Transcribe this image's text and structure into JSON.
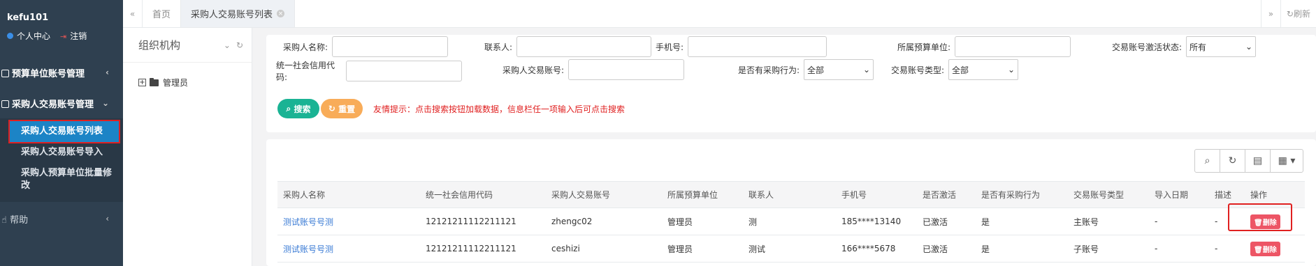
{
  "user": {
    "name": "kefu101",
    "personal": "个人中心",
    "logout": "注销"
  },
  "sidebar": {
    "group1": "预算单位账号管理",
    "group2": "采购人交易账号管理",
    "items": [
      "采购人交易账号列表",
      "采购人交易账号导入",
      "采购人预算单位批量修改"
    ],
    "help": "帮助"
  },
  "tabs": {
    "home": "首页",
    "current": "采购人交易账号列表",
    "refresh": "刷新"
  },
  "tree": {
    "title": "组织机构",
    "node": "管理员"
  },
  "search": {
    "buyer_name": "采购人名称:",
    "contact": "联系人:",
    "phone": "手机号:",
    "budget_unit": "所属预算单位:",
    "activation_status": "交易账号激活状态:",
    "activation_value": "所有",
    "credit_code": "统一社会信用代码:",
    "trade_account": "采购人交易账号:",
    "has_purchase": "是否有采购行为:",
    "has_purchase_value": "全部",
    "account_type": "交易账号类型:",
    "account_type_value": "全部",
    "search_btn": "搜索",
    "reset_btn": "重置",
    "hint": "友情提示：点击搜索按钮加载数据，信息栏任一项输入后可点击搜索"
  },
  "table": {
    "headers": [
      "采购人名称",
      "统一社会信用代码",
      "采购人交易账号",
      "所属预算单位",
      "联系人",
      "手机号",
      "是否激活",
      "是否有采购行为",
      "交易账号类型",
      "导入日期",
      "描述",
      "操作"
    ],
    "rows": [
      [
        "测试账号号测",
        "121212111122111 21",
        "zhengc02",
        "管理员",
        "测",
        "185****13140",
        "已激活",
        "是",
        "主账号",
        "-",
        "-",
        "删除"
      ],
      [
        "测试账号号测",
        "12121211112211121",
        "ceshizi",
        "管理员",
        "测试",
        "166****5678",
        "已激活",
        "是",
        "子账号",
        "-",
        "-",
        "删除"
      ]
    ]
  },
  "colors": {
    "sidebar": "#2f4050",
    "active": "#1c84c6",
    "search": "#1ab394",
    "reset": "#f8ac59",
    "delete": "#ed5565"
  }
}
